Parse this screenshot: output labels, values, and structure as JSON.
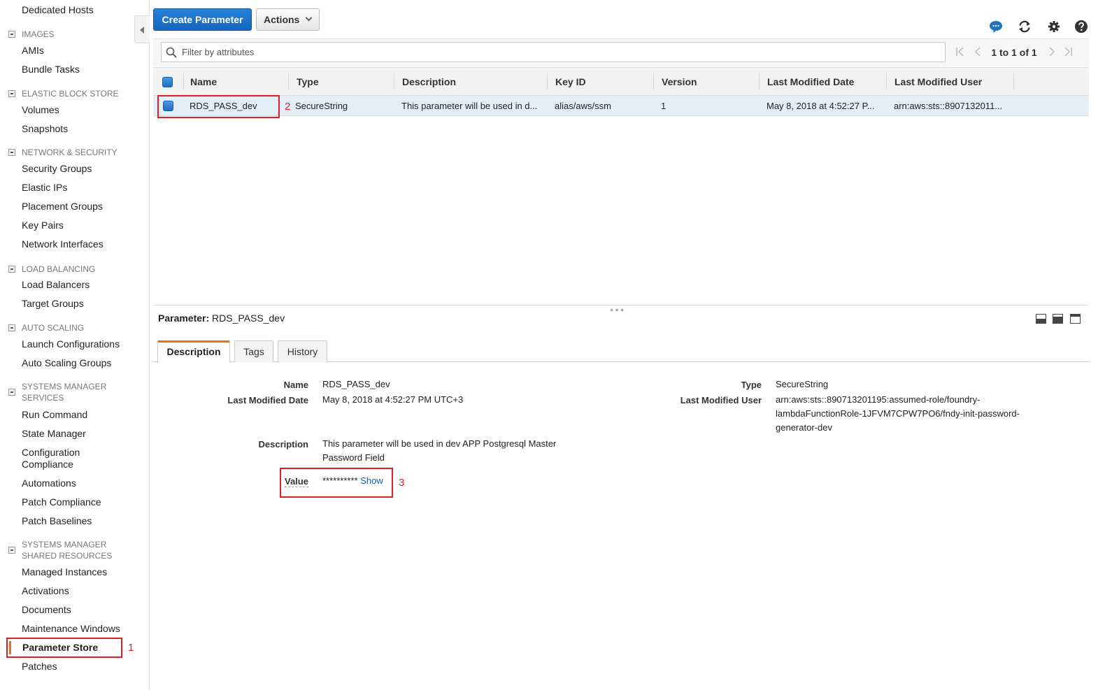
{
  "sidebar": {
    "top_partial_item": "Dedicated Hosts",
    "sections": [
      {
        "title": "IMAGES",
        "items": [
          "AMIs",
          "Bundle Tasks"
        ]
      },
      {
        "title": "ELASTIC BLOCK STORE",
        "items": [
          "Volumes",
          "Snapshots"
        ]
      },
      {
        "title": "NETWORK & SECURITY",
        "items": [
          "Security Groups",
          "Elastic IPs",
          "Placement Groups",
          "Key Pairs",
          "Network Interfaces"
        ]
      },
      {
        "title": "LOAD BALANCING",
        "items": [
          "Load Balancers",
          "Target Groups"
        ]
      },
      {
        "title": "AUTO SCALING",
        "items": [
          "Launch Configurations",
          "Auto Scaling Groups"
        ]
      },
      {
        "title": "SYSTEMS MANAGER SERVICES",
        "items": [
          "Run Command",
          "State Manager",
          "Configuration Compliance",
          "Automations",
          "Patch Compliance",
          "Patch Baselines"
        ]
      },
      {
        "title": "SYSTEMS MANAGER SHARED RESOURCES",
        "items": [
          "Managed Instances",
          "Activations",
          "Documents",
          "Maintenance Windows",
          "Parameter Store",
          "Patches"
        ]
      }
    ],
    "active_item": "Parameter Store",
    "accent_color": "#ec7211"
  },
  "toolbar": {
    "create_label": "Create Parameter",
    "actions_label": "Actions",
    "icons": [
      "chat-icon",
      "refresh-icon",
      "gear-icon",
      "help-icon"
    ]
  },
  "filter": {
    "placeholder": "Filter by attributes"
  },
  "pagination": {
    "text": "1 to 1 of 1"
  },
  "table": {
    "columns": [
      "Name",
      "Type",
      "Description",
      "Key ID",
      "Version",
      "Last Modified Date",
      "Last Modified User"
    ],
    "rows": [
      {
        "name": "RDS_PASS_dev",
        "type": "SecureString",
        "description": "This parameter will be used in d...",
        "key_id": "alias/aws/ssm",
        "version": "1",
        "last_modified_date": "May 8, 2018 at 4:52:27 P...",
        "last_modified_user": "arn:aws:sts::8907132011..."
      }
    ]
  },
  "detail": {
    "title_label": "Parameter:",
    "title_value": "RDS_PASS_dev",
    "tabs": [
      "Description",
      "Tags",
      "History"
    ],
    "fields": {
      "name_label": "Name",
      "name_value": "RDS_PASS_dev",
      "lmd_label": "Last Modified Date",
      "lmd_value": "May 8, 2018 at 4:52:27 PM UTC+3",
      "desc_label": "Description",
      "desc_value_1": "This parameter will be used in dev APP Postgresql Master",
      "desc_value_2": "Password Field",
      "value_label": "Value",
      "value_masked": "**********",
      "value_show": "Show",
      "type_label": "Type",
      "type_value": "SecureString",
      "lmu_label": "Last Modified User",
      "lmu_value_1": "arn:aws:sts::890713201195:assumed-role/foundry-",
      "lmu_value_2": "lambdaFunctionRole-1JFVM7CPW7PO6/fndy-init-password-",
      "lmu_value_3": "generator-dev"
    }
  },
  "annotations": {
    "one": "1",
    "two": "2",
    "three": "3",
    "color": "#e02020"
  }
}
